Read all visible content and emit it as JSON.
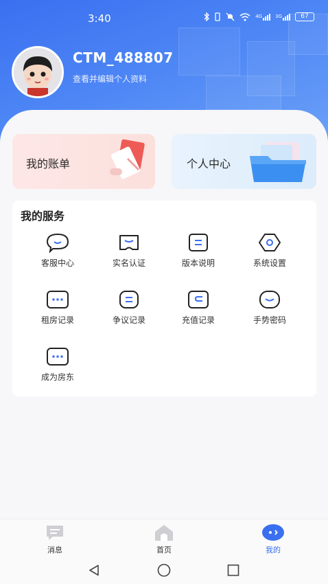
{
  "status_bar": {
    "time": "3:40",
    "icons": [
      "bluetooth-icon",
      "vibrate-icon",
      "mute-icon",
      "wifi-icon",
      "signal-4g-icon",
      "signal-3g-icon"
    ],
    "network_a": "4G",
    "network_b": "3G",
    "battery": "67"
  },
  "profile": {
    "username": "CTM_488807",
    "edit_hint": "查看并编辑个人资料"
  },
  "cards": {
    "bill_label": "我的账单",
    "center_label": "个人中心"
  },
  "services": {
    "title": "我的服务",
    "items": [
      {
        "label": "客服中心",
        "icon": "chat-bubble-icon"
      },
      {
        "label": "实名认证",
        "icon": "id-verify-icon"
      },
      {
        "label": "版本说明",
        "icon": "document-icon"
      },
      {
        "label": "系统设置",
        "icon": "settings-icon"
      },
      {
        "label": "租房记录",
        "icon": "rent-record-icon"
      },
      {
        "label": "争议记录",
        "icon": "dispute-record-icon"
      },
      {
        "label": "充值记录",
        "icon": "wallet-icon"
      },
      {
        "label": "手势密码",
        "icon": "gesture-lock-icon"
      },
      {
        "label": "成为房东",
        "icon": "landlord-icon"
      }
    ]
  },
  "tabs": [
    {
      "label": "消息",
      "icon": "message-icon",
      "active": false
    },
    {
      "label": "首页",
      "icon": "home-icon",
      "active": false
    },
    {
      "label": "我的",
      "icon": "profile-icon",
      "active": true
    }
  ],
  "colors": {
    "primary": "#3a6ff0",
    "hero_light": "#6ea4f8",
    "bill_bg": "#fde7e6",
    "center_bg": "#e8f3fd"
  }
}
